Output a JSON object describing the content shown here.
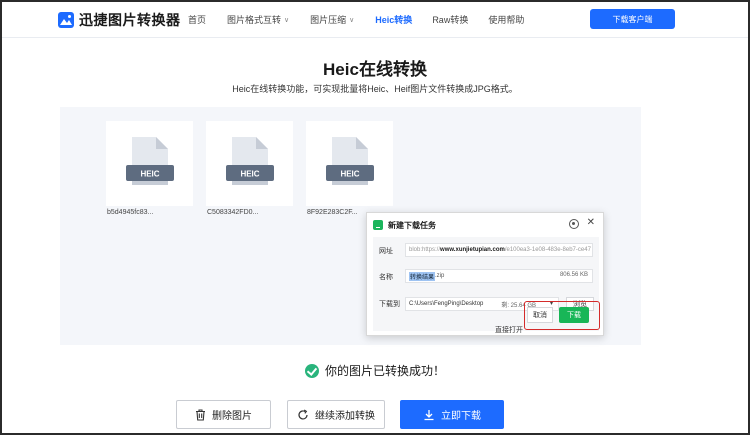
{
  "header": {
    "logo_text": "迅捷图片转换器",
    "nav": [
      {
        "label": "首页",
        "dropdown": false,
        "active": false
      },
      {
        "label": "图片格式互转",
        "dropdown": true,
        "active": false
      },
      {
        "label": "图片压缩",
        "dropdown": true,
        "active": false
      },
      {
        "label": "Heic转换",
        "dropdown": false,
        "active": true
      },
      {
        "label": "Raw转换",
        "dropdown": false,
        "active": false
      },
      {
        "label": "使用帮助",
        "dropdown": false,
        "active": false
      }
    ],
    "download_client_label": "下载客户端"
  },
  "page": {
    "title": "Heic在线转换",
    "subtitle": "Heic在线转换功能，可实现批量将Heic、Heif图片文件转换成JPG格式。"
  },
  "files": [
    {
      "badge": "HEIC",
      "name": "b5d4945fc83..."
    },
    {
      "badge": "HEIC",
      "name": "C5083342FD0..."
    },
    {
      "badge": "HEIC",
      "name": "8F92E283C2F..."
    }
  ],
  "dialog": {
    "title": "新建下载任务",
    "url_label": "网址",
    "url_prefix": "blob:https://",
    "url_domain": "www.xunjietupian.com",
    "url_suffix": "/e100ea3-1e08-483e-8eb7-ce47",
    "name_label": "名称",
    "file_name_highlight": "转换结果",
    "file_name_ext": ".zip",
    "file_size": "806.56 KB",
    "save_label": "下载到",
    "save_path": "C:\\Users\\FengPing\\Desktop",
    "free_space": "剩: 25.64 GB",
    "browse_label": "浏览",
    "open_label": "直接打开",
    "cancel_label": "取消",
    "download_label": "下载"
  },
  "status": {
    "success_text": "你的图片已转换成功！"
  },
  "actions": {
    "delete_label": "删除图片",
    "continue_label": "继续添加转换",
    "download_now_label": "立即下载"
  },
  "colors": {
    "brand": "#1d6bff",
    "success": "#29b47c",
    "dialog_green": "#18b657",
    "highlight_red": "#d42b2b",
    "file_badge": "#5e6c80"
  }
}
